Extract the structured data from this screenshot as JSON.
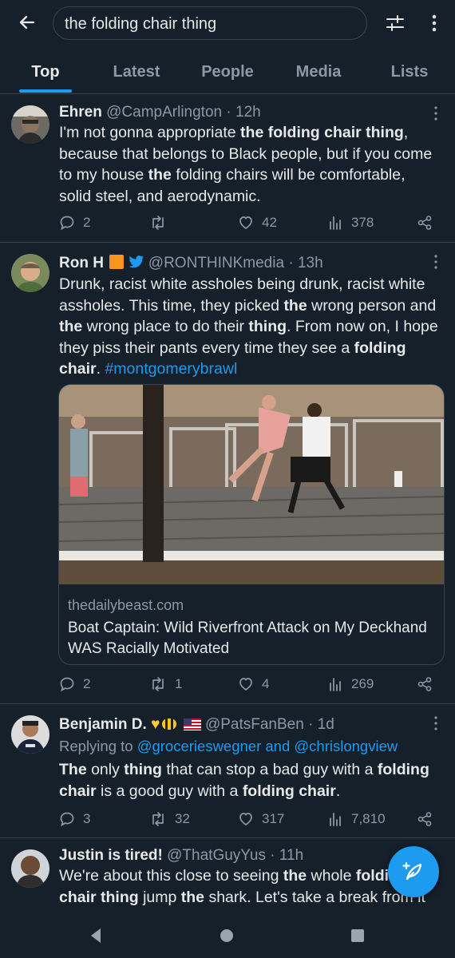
{
  "search": {
    "query": "the folding chair thing"
  },
  "tabs": [
    {
      "label": "Top"
    },
    {
      "label": "Latest"
    },
    {
      "label": "People"
    },
    {
      "label": "Media"
    },
    {
      "label": "Lists"
    }
  ],
  "tweets": [
    {
      "name": "Ehren",
      "handle": "@CampArlington",
      "time": "12h",
      "text_parts": [
        {
          "t": "I'm not gonna appropriate ",
          "b": false
        },
        {
          "t": "the folding chair thing",
          "b": true
        },
        {
          "t": ", because that belongs to Black people, but if you come to my house ",
          "b": false
        },
        {
          "t": "the",
          "b": true
        },
        {
          "t": " folding chairs will be comfortable, solid steel, and aerodynamic.",
          "b": false
        }
      ],
      "replies": "2",
      "retweets": "",
      "likes": "42",
      "views": "378"
    },
    {
      "name": "Ron H",
      "handle": "@RONTHINKmedia",
      "time": "13h",
      "text_parts": [
        {
          "t": "Drunk, racist white assholes being drunk, racist white assholes. This time, they picked ",
          "b": false
        },
        {
          "t": "the",
          "b": true
        },
        {
          "t": " wrong person and ",
          "b": false
        },
        {
          "t": "the",
          "b": true
        },
        {
          "t": " wrong place to do their ",
          "b": false
        },
        {
          "t": "thing",
          "b": true
        },
        {
          "t": ". From now on, I hope they piss their pants every time they see a ",
          "b": false
        },
        {
          "t": "folding chair",
          "b": true
        },
        {
          "t": ". ",
          "b": false
        },
        {
          "t": "#montgomerybrawl",
          "b": false,
          "link": true
        }
      ],
      "card": {
        "domain": "thedailybeast.com",
        "title": "Boat Captain: Wild Riverfront Attack on My Deckhand WAS Racially Motivated"
      },
      "replies": "2",
      "retweets": "1",
      "likes": "4",
      "views": "269"
    },
    {
      "name": "Benjamin D.",
      "handle": "@PatsFanBen",
      "time": "1d",
      "reply_prefix": "Replying to ",
      "reply_targets": "@grocerieswegner and @chrislongview",
      "text_parts": [
        {
          "t": "The",
          "b": true
        },
        {
          "t": " only ",
          "b": false
        },
        {
          "t": "thing",
          "b": true
        },
        {
          "t": " that can stop a bad guy with a ",
          "b": false
        },
        {
          "t": "folding chair",
          "b": true
        },
        {
          "t": " is a good guy with a ",
          "b": false
        },
        {
          "t": "folding chair",
          "b": true
        },
        {
          "t": ".",
          "b": false
        }
      ],
      "replies": "3",
      "retweets": "32",
      "likes": "317",
      "views": "7,810"
    },
    {
      "name": "Justin is tired!",
      "handle": "@ThatGuyYus",
      "time": "11h",
      "text_parts": [
        {
          "t": "We're about this close to seeing ",
          "b": false
        },
        {
          "t": "the",
          "b": true
        },
        {
          "t": " whole ",
          "b": false
        },
        {
          "t": "folding chair thing",
          "b": true
        },
        {
          "t": " jump ",
          "b": false
        },
        {
          "t": "the",
          "b": true
        },
        {
          "t": " shark. Let's take a break from it",
          "b": false
        }
      ]
    }
  ],
  "colors": {
    "background": "#15202b",
    "accent": "#1d9bf0",
    "secondary_text": "#8b98a5",
    "divider": "#38444d"
  },
  "icons": {
    "back": "arrow-left-icon",
    "filter": "sliders-icon",
    "more": "vertical-dots-icon",
    "reply": "speech-bubble-icon",
    "retweet": "retweet-icon",
    "like": "heart-icon",
    "views": "bar-chart-icon",
    "share": "share-icon",
    "compose": "feather-plus-icon"
  }
}
